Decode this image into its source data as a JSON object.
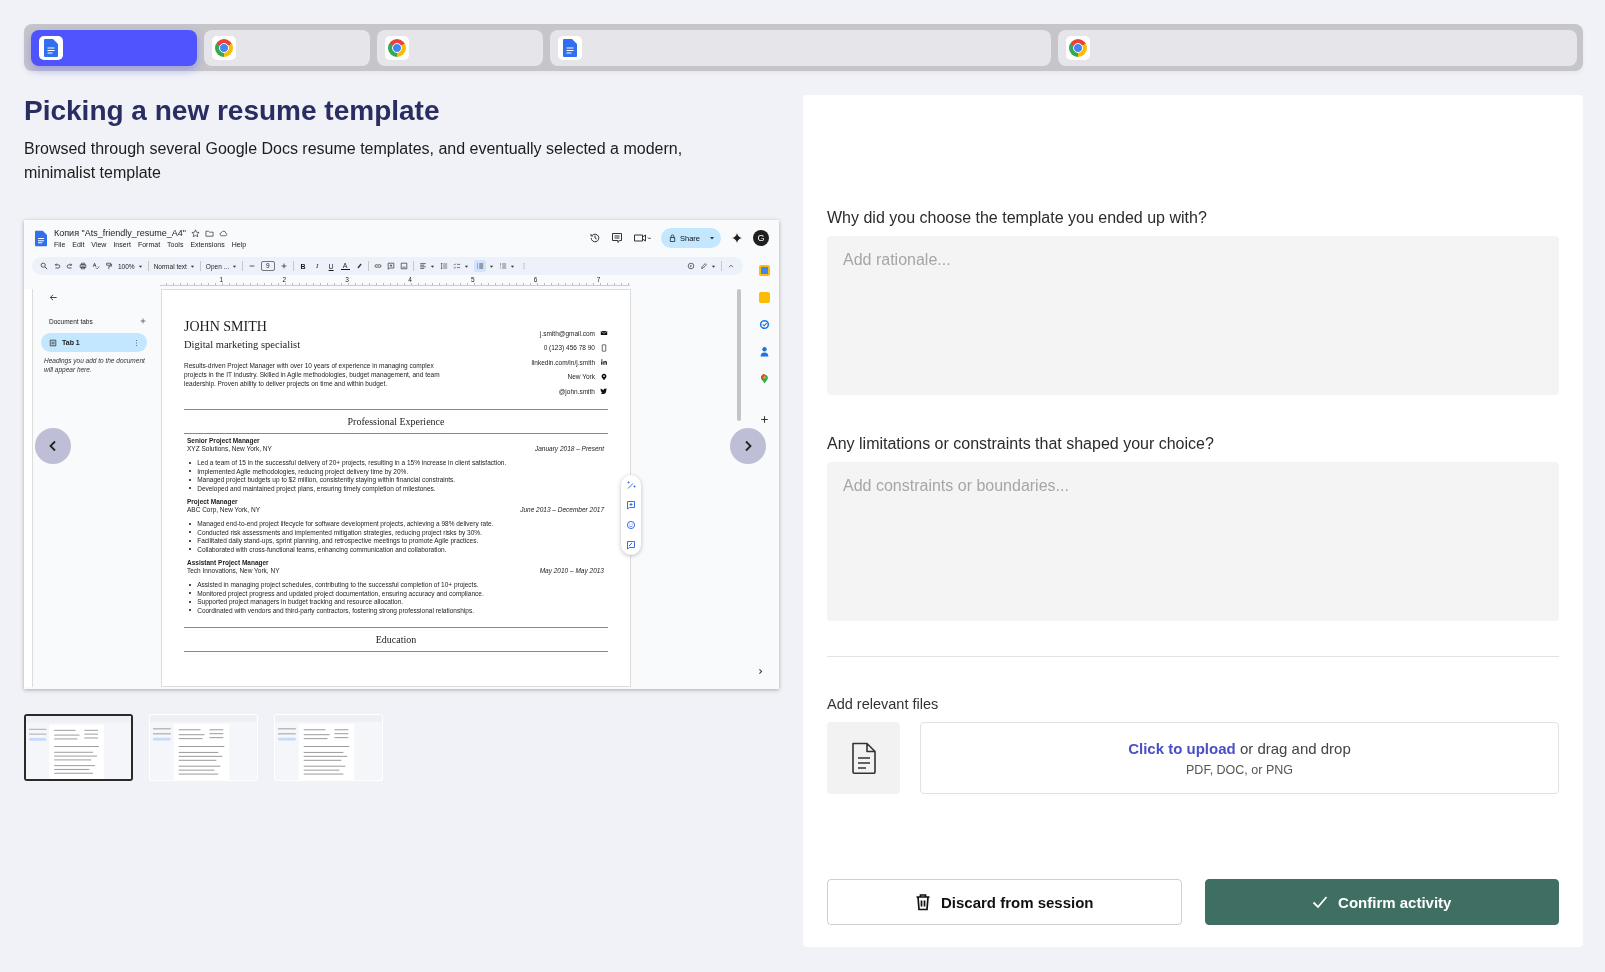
{
  "tabs": [
    {
      "kind": "docs",
      "selected": true
    },
    {
      "kind": "chrome",
      "selected": false
    },
    {
      "kind": "chrome",
      "selected": false
    },
    {
      "kind": "docs",
      "selected": false
    },
    {
      "kind": "chrome",
      "selected": false
    }
  ],
  "activity": {
    "title": "Picking a new resume template",
    "description": "Browsed through several Google Docs resume templates, and eventually selected a modern, minimalist template"
  },
  "screenshot": {
    "doc_title": "Копия \"Ats_friendly_resume_A4\"",
    "menu": [
      "File",
      "Edit",
      "View",
      "Insert",
      "Format",
      "Tools",
      "Extensions",
      "Help"
    ],
    "share": "Share",
    "avatar": "G",
    "zoom": "100%",
    "style": "Normal text",
    "font": "Open ...",
    "font_size": "9",
    "format_buttons": [
      "B",
      "I",
      "U",
      "A"
    ],
    "ruler": [
      "1",
      "2",
      "3",
      "4",
      "5",
      "6",
      "7"
    ],
    "sidebar": {
      "heading": "Document tabs",
      "tab": "Tab 1",
      "hint": "Headings you add to the document will appear here."
    },
    "resume": {
      "name": "JOHN SMITH",
      "role": "Digital marketing specialist",
      "summary": "Results-driven Project Manager with over 10 years of experience in managing complex projects in the IT industry. Skilled in Agile methodologies, budget management, and team leadership. Proven ability to deliver projects on time and within budget.",
      "contacts": [
        {
          "kind": "email",
          "text": "j.smith@gmail.com"
        },
        {
          "kind": "phone",
          "text": "0 (123) 456 78 90"
        },
        {
          "kind": "linkedin",
          "text": "linkedin.com/in/j.smith"
        },
        {
          "kind": "location",
          "text": "New York"
        },
        {
          "kind": "twitter",
          "text": "@john.smith"
        }
      ],
      "sections": [
        {
          "heading": "Professional Experience",
          "jobs": [
            {
              "title": "Senior Project Manager",
              "company": "XYZ Solutions, New York, NY",
              "dates": "January 2018 – Present",
              "bullets": [
                "Led a team of 15 in the successful delivery of 20+ projects, resulting in a 15% increase in client satisfaction.",
                "Implemented Agile methodologies, reducing project delivery time by 20%.",
                "Managed project budgets up to $2 million, consistently staying within financial constraints.",
                "Developed and maintained project plans, ensuring timely completion of milestones."
              ]
            },
            {
              "title": "Project Manager",
              "company": "ABC Corp, New York, NY",
              "dates": "June 2013 – December 2017",
              "bullets": [
                "Managed end-to-end project lifecycle for software development projects, achieving a 98% delivery rate.",
                "Conducted risk assessments and implemented mitigation strategies, reducing project risks by 30%.",
                "Facilitated daily stand-ups, sprint planning, and retrospective meetings to promote Agile practices.",
                "Collaborated with cross-functional teams, enhancing communication and collaboration."
              ]
            },
            {
              "title": "Assistant Project Manager",
              "company": "Tech Innovations, New York, NY",
              "dates": "May 2010 – May 2013",
              "bullets": [
                "Assisted in managing project schedules, contributing to the successful completion of 10+ projects.",
                "Monitored project progress and updated project documentation, ensuring accuracy and compliance.",
                "Supported project managers in budget tracking and resource allocation.",
                "Coordinated with vendors and third-party contractors, fostering strong professional relationships."
              ]
            }
          ]
        },
        {
          "heading": "Education"
        }
      ]
    }
  },
  "thumbnails": [
    {
      "selected": true
    },
    {
      "selected": false
    },
    {
      "selected": false
    }
  ],
  "questions": [
    {
      "label": "Why did you choose the template you ended up with?",
      "placeholder": "Add rationale..."
    },
    {
      "label": "Any limitations or constraints that shaped your choice?",
      "placeholder": "Add constraints or boundaries..."
    }
  ],
  "files": {
    "label": "Add relevant files",
    "link": "Click to upload",
    "rest": "or drag and drop",
    "formats": "PDF, DOC, or PNG"
  },
  "buttons": [
    {
      "kind": "discard",
      "label": "Discard from session"
    },
    {
      "kind": "confirm",
      "label": "Confirm activity"
    }
  ]
}
